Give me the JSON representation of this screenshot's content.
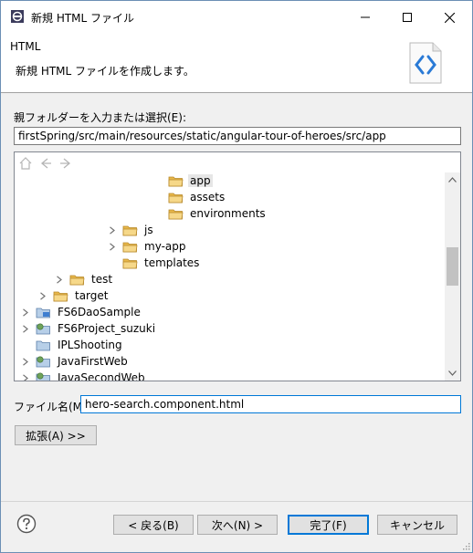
{
  "window": {
    "title": "新規 HTML ファイル"
  },
  "banner": {
    "title": "HTML",
    "description": "新規 HTML ファイルを作成します。"
  },
  "parent_folder": {
    "label": "親フォルダーを入力または選択(E):",
    "value": "firstSpring/src/main/resources/static/angular-tour-of-heroes/src/app"
  },
  "tree": {
    "items": [
      {
        "label": "app",
        "kind": "folder",
        "selected": true,
        "expander": "none"
      },
      {
        "label": "assets",
        "kind": "folder",
        "expander": "none"
      },
      {
        "label": "environments",
        "kind": "folder",
        "expander": "none"
      },
      {
        "label": "js",
        "kind": "folder",
        "expander": "collapsed"
      },
      {
        "label": "my-app",
        "kind": "folder",
        "expander": "collapsed"
      },
      {
        "label": "templates",
        "kind": "folder",
        "expander": "none"
      },
      {
        "label": "test",
        "kind": "folder",
        "expander": "collapsed"
      },
      {
        "label": "target",
        "kind": "folder",
        "expander": "collapsed"
      },
      {
        "label": "FS6DaoSample",
        "kind": "project-java",
        "expander": "collapsed"
      },
      {
        "label": "FS6Project_suzuki",
        "kind": "project-web",
        "expander": "collapsed"
      },
      {
        "label": "IPLShooting",
        "kind": "project-plain",
        "expander": "none"
      },
      {
        "label": "JavaFirstWeb",
        "kind": "project-web",
        "expander": "collapsed"
      },
      {
        "label": "JavaSecondWeb",
        "kind": "project-web",
        "expander": "collapsed"
      }
    ]
  },
  "file_name": {
    "label": "ファイル名(M):",
    "value": "hero-search.component.html"
  },
  "buttons": {
    "advanced": "拡張(A) >>",
    "back": "< 戻る(B)",
    "next": "次へ(N) >",
    "finish": "完了(F)",
    "cancel": "キャンセル"
  },
  "colors": {
    "accent": "#0078d7",
    "folder": "#e8b84a",
    "tree_selection": "#e6e6e6"
  }
}
